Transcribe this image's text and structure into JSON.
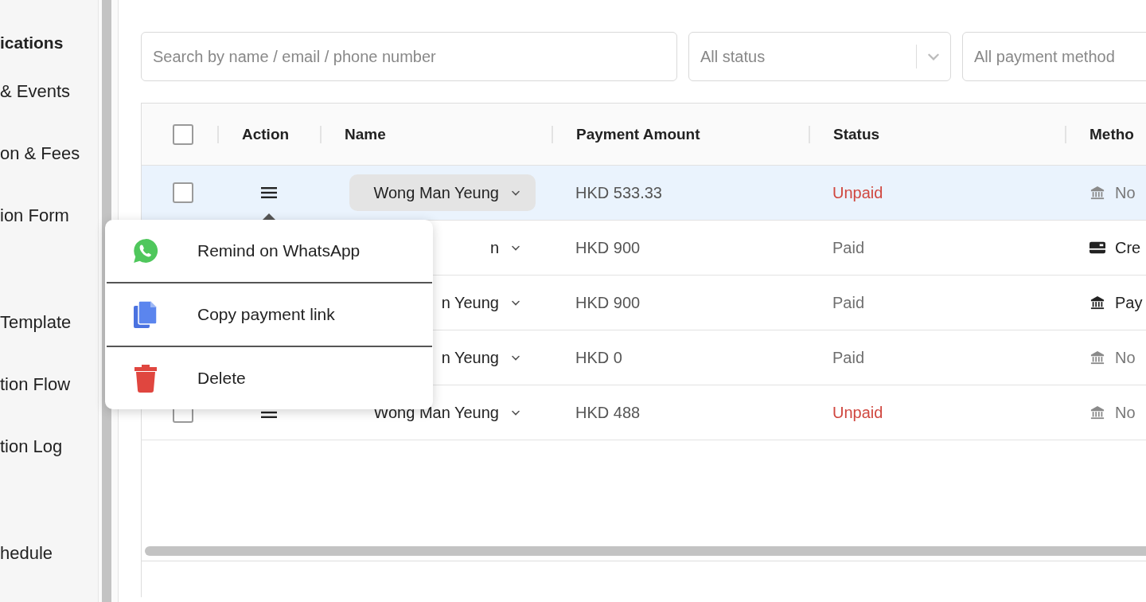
{
  "sidebar": {
    "heading": "ications",
    "sections": [
      {
        "items": [
          "& Events",
          "on & Fees",
          "ion Form"
        ]
      },
      {
        "items": [
          "Template",
          "tion Flow",
          "tion Log"
        ]
      },
      {
        "items": [
          "hedule"
        ]
      }
    ]
  },
  "filters": {
    "search": {
      "placeholder": "Search by name / email / phone number"
    },
    "status": {
      "value": "All status"
    },
    "payment_method": {
      "value": "All payment method"
    }
  },
  "table": {
    "header_checked": false,
    "columns": [
      "Action",
      "Name",
      "Payment Amount",
      "Status",
      "Metho"
    ],
    "rows": [
      {
        "selected": true,
        "checked": false,
        "name": "Wong Man Yeung",
        "amount": "HKD 533.33",
        "status": {
          "label": "Unpaid",
          "color": "#d0473f"
        },
        "method": {
          "kind": "bank",
          "label": "No",
          "muted": true
        }
      },
      {
        "selected": false,
        "name": "n",
        "amount": "HKD 900",
        "status": {
          "label": "Paid",
          "color": "#6f6f6f"
        },
        "method": {
          "kind": "card",
          "label": "Cre",
          "muted": false
        }
      },
      {
        "selected": false,
        "name": "n Yeung",
        "amount": "HKD 900",
        "status": {
          "label": "Paid",
          "color": "#6f6f6f"
        },
        "method": {
          "kind": "bank",
          "label": "Pay",
          "muted": false
        }
      },
      {
        "selected": false,
        "name": "n Yeung",
        "amount": "HKD 0",
        "status": {
          "label": "Paid",
          "color": "#6f6f6f"
        },
        "method": {
          "kind": "bank",
          "label": "No",
          "muted": true
        }
      },
      {
        "selected": false,
        "checked": false,
        "name": "Wong Man Yeung",
        "amount": "HKD 488",
        "status": {
          "label": "Unpaid",
          "color": "#d0473f"
        },
        "method": {
          "kind": "bank",
          "label": "No",
          "muted": true
        }
      }
    ]
  },
  "action_menu": {
    "items": [
      {
        "kind": "whatsapp",
        "label": "Remind on WhatsApp"
      },
      {
        "kind": "copy",
        "label": "Copy payment link"
      },
      {
        "kind": "delete",
        "label": "Delete"
      }
    ]
  }
}
